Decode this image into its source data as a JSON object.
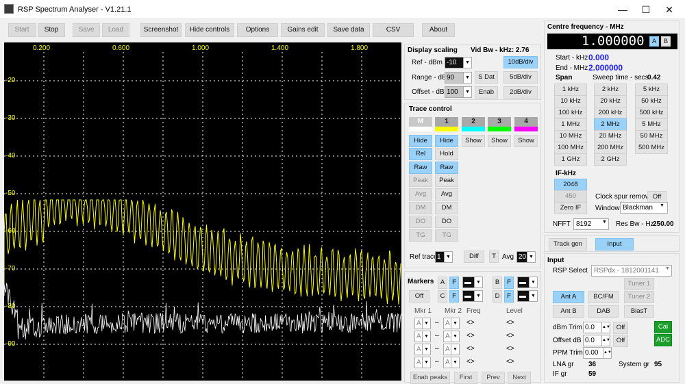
{
  "window": {
    "title": "RSP Spectrum Analyser - V1.21.1",
    "minimize": "—",
    "maximize": "☐",
    "close": "✕"
  },
  "toolbar": {
    "start": "Start",
    "stop": "Stop",
    "save": "Save",
    "load": "Load",
    "screenshot": "Screenshot",
    "hide_controls": "Hide controls",
    "options": "Options",
    "gains_edit": "Gains edit",
    "save_data": "Save data",
    "csv": "CSV",
    "about": "About"
  },
  "plot": {
    "x_ticks": [
      "0.200",
      "0.600",
      "1.000",
      "1.400",
      "1.800"
    ],
    "y_ticks": [
      "-20",
      "-30",
      "-40",
      "-50",
      "-60",
      "-70",
      "-80",
      "-90"
    ],
    "background": "#000000",
    "trace_color": "#ffff00",
    "ref_trace_color": "#ffffff",
    "grid_color": "#ffffff"
  },
  "display_scaling": {
    "title": "Display scaling",
    "vid_bw": "Vid Bw - kHz: 2.76",
    "ref_label": "Ref - dBm",
    "ref_value": "-10",
    "range_label": "Range - dB",
    "range_value": "90",
    "offset_label": "Offset - dB",
    "offset_value": "100",
    "btn_10db": "10dB/div",
    "btn_sdat": "S Dat",
    "btn_5db": "5dB/div",
    "btn_enab": "Enab",
    "btn_2db": "2dB/div"
  },
  "trace_control": {
    "title": "Trace control",
    "channels": [
      {
        "label": "M",
        "color": "#ffffff"
      },
      {
        "label": "1",
        "color": "#ffff00"
      },
      {
        "label": "2",
        "color": "#00ffff"
      },
      {
        "label": "3",
        "color": "#00ff00"
      },
      {
        "label": "4",
        "color": "#ff00ff"
      }
    ],
    "m_col": [
      "Hide",
      "Rel",
      "Raw",
      "Peak",
      "Avg",
      "DM",
      "DO",
      "TG"
    ],
    "c1_col": [
      "Hide",
      "Hold",
      "Raw",
      "Peak",
      "Avg",
      "DM",
      "DO",
      "TG"
    ],
    "show": "Show",
    "ref_trace_label": "Ref trace",
    "ref_trace_value": "1",
    "diff": "Diff",
    "t": "T",
    "avg_label": "Avg",
    "avg_value": "20"
  },
  "markers": {
    "title": "Markers",
    "a": "A",
    "f": "F",
    "b": "B",
    "c": "C",
    "d": "D",
    "off": "Off",
    "mkr1": "Mkr 1",
    "mkr2": "Mkr 2",
    "freq": "Freq",
    "level": "Level",
    "row_val": "A",
    "dash": "–",
    "empty": "<>",
    "enab_peaks": "Enab peaks",
    "first": "First",
    "prev": "Prev",
    "next": "Next"
  },
  "centre": {
    "title": "Centre frequency - MHz",
    "value": "1.000000",
    "a": "A",
    "b": "B",
    "start_label": "Start - kHz",
    "start_value": "0.000",
    "end_label": "End - MHz",
    "end_value": "2.000000",
    "span_label": "Span",
    "sweep_label": "Sweep time - secs",
    "sweep_value": "0.42",
    "span_buttons": [
      "1 kHz",
      "2 kHz",
      "5 kHz",
      "10 kHz",
      "20 kHz",
      "50 kHz",
      "100 kHz",
      "200 kHz",
      "500 kHz",
      "1 MHz",
      "2 MHz",
      "5 MHz",
      "10 MHz",
      "20 MHz",
      "50 MHz",
      "100 MHz",
      "200 MHz",
      "500 MHz",
      "1 GHz",
      "2 GHz"
    ],
    "if_label": "IF-kHz",
    "if_2048": "2048",
    "if_450": "450",
    "zero_if": "Zero IF",
    "clock_spur": "Clock spur removal",
    "clock_off": "Off",
    "window_label": "Window",
    "window_value": "Blackman",
    "nfft_label": "NFFT",
    "nfft_value": "8192",
    "resbw_label": "Res Bw - Hz",
    "resbw_value": "250.00"
  },
  "trackgen": {
    "track_gen": "Track gen",
    "input": "Input"
  },
  "input": {
    "title": "Input",
    "rsp_select": "RSP Select",
    "rsp_value": "RSPdx - 1812001141",
    "tuner1": "Tuner 1",
    "tuner2": "Tuner 2",
    "ant_a": "Ant A",
    "bcfm": "BC/FM",
    "ant_b": "Ant B",
    "dab": "DAB",
    "biast": "BiasT",
    "dbm_trim": "dBm Trim",
    "dbm_trim_value": "0.0",
    "offset_db": "Offset dB",
    "offset_db_value": "0.0",
    "ppm_trim": "PPM Trim",
    "ppm_value": "0.00",
    "off": "Off",
    "cal": "Cal",
    "adc": "ADC",
    "lna_label": "LNA gr",
    "lna_value": "36",
    "system_label": "System gr",
    "system_value": "95",
    "if_gr_label": "IF gr",
    "if_gr_value": "59"
  }
}
